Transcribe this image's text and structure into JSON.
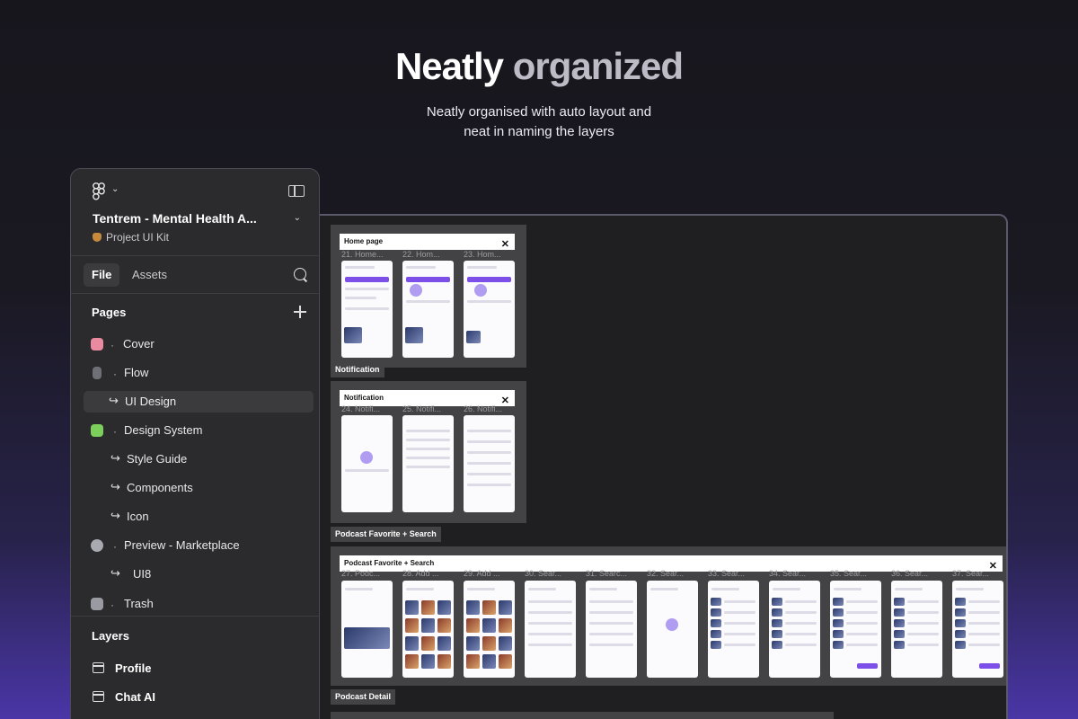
{
  "hero": {
    "title_part1": "Neatly",
    "title_part2": "organized",
    "subtitle_line1": "Neatly organised with auto layout and",
    "subtitle_line2": "neat in naming the layers"
  },
  "colors": {
    "accent": "#7b4fe8",
    "panel_bg": "#2b2b2d",
    "canvas_bg": "#1f1f21",
    "selected_bg": "#3b3b3e"
  },
  "sidebar": {
    "logo_icon": "figma-logo-icon",
    "project_title": "Tentrem - Mental Health A...",
    "project_subtitle": "Project UI Kit",
    "tabs": [
      {
        "label": "File",
        "active": true
      },
      {
        "label": "Assets",
        "active": false
      }
    ],
    "pages_title": "Pages",
    "pages": [
      {
        "label": "Cover",
        "icon": "brain-emoji",
        "type": "page",
        "selected": false
      },
      {
        "label": "Flow",
        "icon": "stethoscope-emoji",
        "type": "page",
        "selected": false
      },
      {
        "label": "UI Design",
        "icon": "return-arrow",
        "type": "subpage",
        "selected": true
      },
      {
        "label": "Design System",
        "icon": "puzzle-emoji",
        "type": "page",
        "selected": false
      },
      {
        "label": "Style Guide",
        "icon": "return-arrow",
        "type": "subpage",
        "selected": false
      },
      {
        "label": "Components",
        "icon": "return-arrow",
        "type": "subpage",
        "selected": false
      },
      {
        "label": "Icon",
        "icon": "return-arrow",
        "type": "subpage",
        "selected": false
      },
      {
        "label": "Preview - Marketplace",
        "icon": "gear-emoji",
        "type": "page",
        "selected": false
      },
      {
        "label": "UI8",
        "icon": "return-arrow",
        "type": "subpage",
        "selected": false
      },
      {
        "label": "Trash",
        "icon": "wastebasket-emoji",
        "type": "page",
        "selected": false
      }
    ],
    "layers_title": "Layers",
    "layers": [
      {
        "label": "Profile",
        "icon": "frame-icon"
      },
      {
        "label": "Chat AI",
        "icon": "frame-icon"
      }
    ]
  },
  "canvas": {
    "sections": [
      {
        "header": "Home page",
        "tag_below": "Notification",
        "phones": [
          "21. Home...",
          "22. Hom...",
          "23. Hom..."
        ]
      },
      {
        "header": "Notification",
        "tag_below": "Podcast Favorite + Search",
        "phones": [
          "24. Notifi...",
          "25. Notifi...",
          "26. Notifi..."
        ]
      },
      {
        "header": "Podcast Favorite + Search",
        "tag_below": "Podcast Detail",
        "phones": [
          "27. Podc...",
          "28. Add ...",
          "29. Add ...",
          "30. Sear...",
          "31. Searc...",
          "32. Sear...",
          "33. Sear...",
          "34. Sear...",
          "35. Sear...",
          "36. Sear...",
          "37. Sear..."
        ]
      }
    ]
  }
}
